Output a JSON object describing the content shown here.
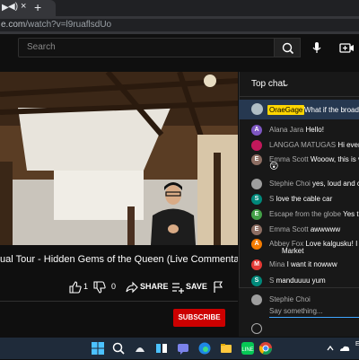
{
  "browser": {
    "tab_title": "▶",
    "tab_audio": "◀)",
    "tab_close": "×",
    "new_tab": "+",
    "url_prefix": "e.com",
    "url_rest": "/watch?v=l9ruaflsdUo"
  },
  "youtube": {
    "search_placeholder": "Search"
  },
  "video": {
    "title": "tual Tour - Hidden Gems of the Queen (Live Commentary)",
    "likes": "1",
    "dislikes": "0",
    "share_label": "SHARE",
    "save_label": "SAVE",
    "subscribe_label": "SUBSCRIBE"
  },
  "chat": {
    "mode_label": "Top chat",
    "pinned": {
      "author": "OraeGage",
      "message": "What if the broadcast"
    },
    "messages": [
      {
        "author": "Alana Jara",
        "message": "Hello!",
        "initial": "A",
        "color": "#7e57c2"
      },
      {
        "author": "LANGGA MATUGAS",
        "message": "Hi everyone",
        "initial": "",
        "color": "#c2185b"
      },
      {
        "author": "Emma Scott",
        "message": "Wooow, this is very",
        "initial": "E",
        "color": "#8d6e63"
      },
      {
        "author": "Stephie Choi",
        "message": "yes, loud and clear",
        "initial": "",
        "color": "#9e9e9e"
      },
      {
        "author": "S",
        "message": "love the cable car",
        "initial": "S",
        "color": "#00897b"
      },
      {
        "author": "Escape from the globe",
        "message": "Yes the p",
        "initial": "E",
        "color": "#43a047"
      },
      {
        "author": "Emma Scott",
        "message": "awwwww",
        "initial": "E",
        "color": "#8d6e63"
      },
      {
        "author": "Abbey Fox",
        "message": "Love kalgusku! I tried",
        "initial": "A",
        "color": "#f57c00"
      },
      {
        "author": "",
        "message": "Market",
        "initial": "",
        "color": ""
      },
      {
        "author": "Mina",
        "message": "I want it nowww",
        "initial": "M",
        "color": "#e53935"
      },
      {
        "author": "S",
        "message": "manduuuu yum",
        "initial": "S",
        "color": "#00897b"
      }
    ],
    "emoji_reply": "😲",
    "input_user": "Stephie Choi",
    "input_placeholder": "Say something..."
  },
  "taskbar": {
    "icons": [
      "windows-start-icon",
      "search-icon",
      "widgets-icon",
      "task-view-icon",
      "chat-icon",
      "edge-icon",
      "explorer-icon",
      "store-icon",
      "line-icon",
      "chrome-icon"
    ],
    "tray_text": "E"
  }
}
